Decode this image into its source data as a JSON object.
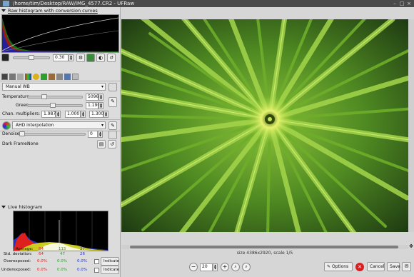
{
  "window": {
    "title": "/home/tim/Desktop/RAW/IMG_4577.CR2 - UFRaw"
  },
  "raw_histogram": {
    "label": "Raw histogram with conversion curves"
  },
  "exposure": {
    "value": "0.30"
  },
  "white_balance": {
    "preset": "Manual WB",
    "temperature_label": "Temperature",
    "temperature_value": "5096",
    "green_label": "Green",
    "green_value": "1.190",
    "chan_label": "Chan. multipliers:",
    "chan_values": [
      "1.987",
      "1.000",
      "1.300"
    ]
  },
  "interpolation": {
    "value": "AHD interpolation"
  },
  "denoise": {
    "label": "Denoise",
    "value": "0"
  },
  "dark_frame": {
    "label": "Dark Frame:",
    "value": "None"
  },
  "live_histogram": {
    "label": "Live histogram"
  },
  "stats": {
    "average_label": "Average:",
    "stddev_label": "Std. deviation:",
    "overexposed_label": "Overexposed:",
    "underexposed_label": "Underexposed:",
    "average": [
      "84",
      "115",
      "27"
    ],
    "stddev": [
      "64",
      "47",
      "26"
    ],
    "overexposed": [
      "0.0%",
      "0.0%",
      "0.0%"
    ],
    "underexposed": [
      "0.0%",
      "0.0%",
      "0.0%"
    ],
    "indicate_label": "Indicate",
    "colors": {
      "red": "#e0201c",
      "green": "#2aa12a",
      "blue": "#2233cc"
    }
  },
  "status": {
    "text": "size 4386x2920, scale 1/5"
  },
  "zoom": {
    "value": "20"
  },
  "buttons": {
    "options": "Options",
    "cancel": "Cancel",
    "save": "Save"
  }
}
